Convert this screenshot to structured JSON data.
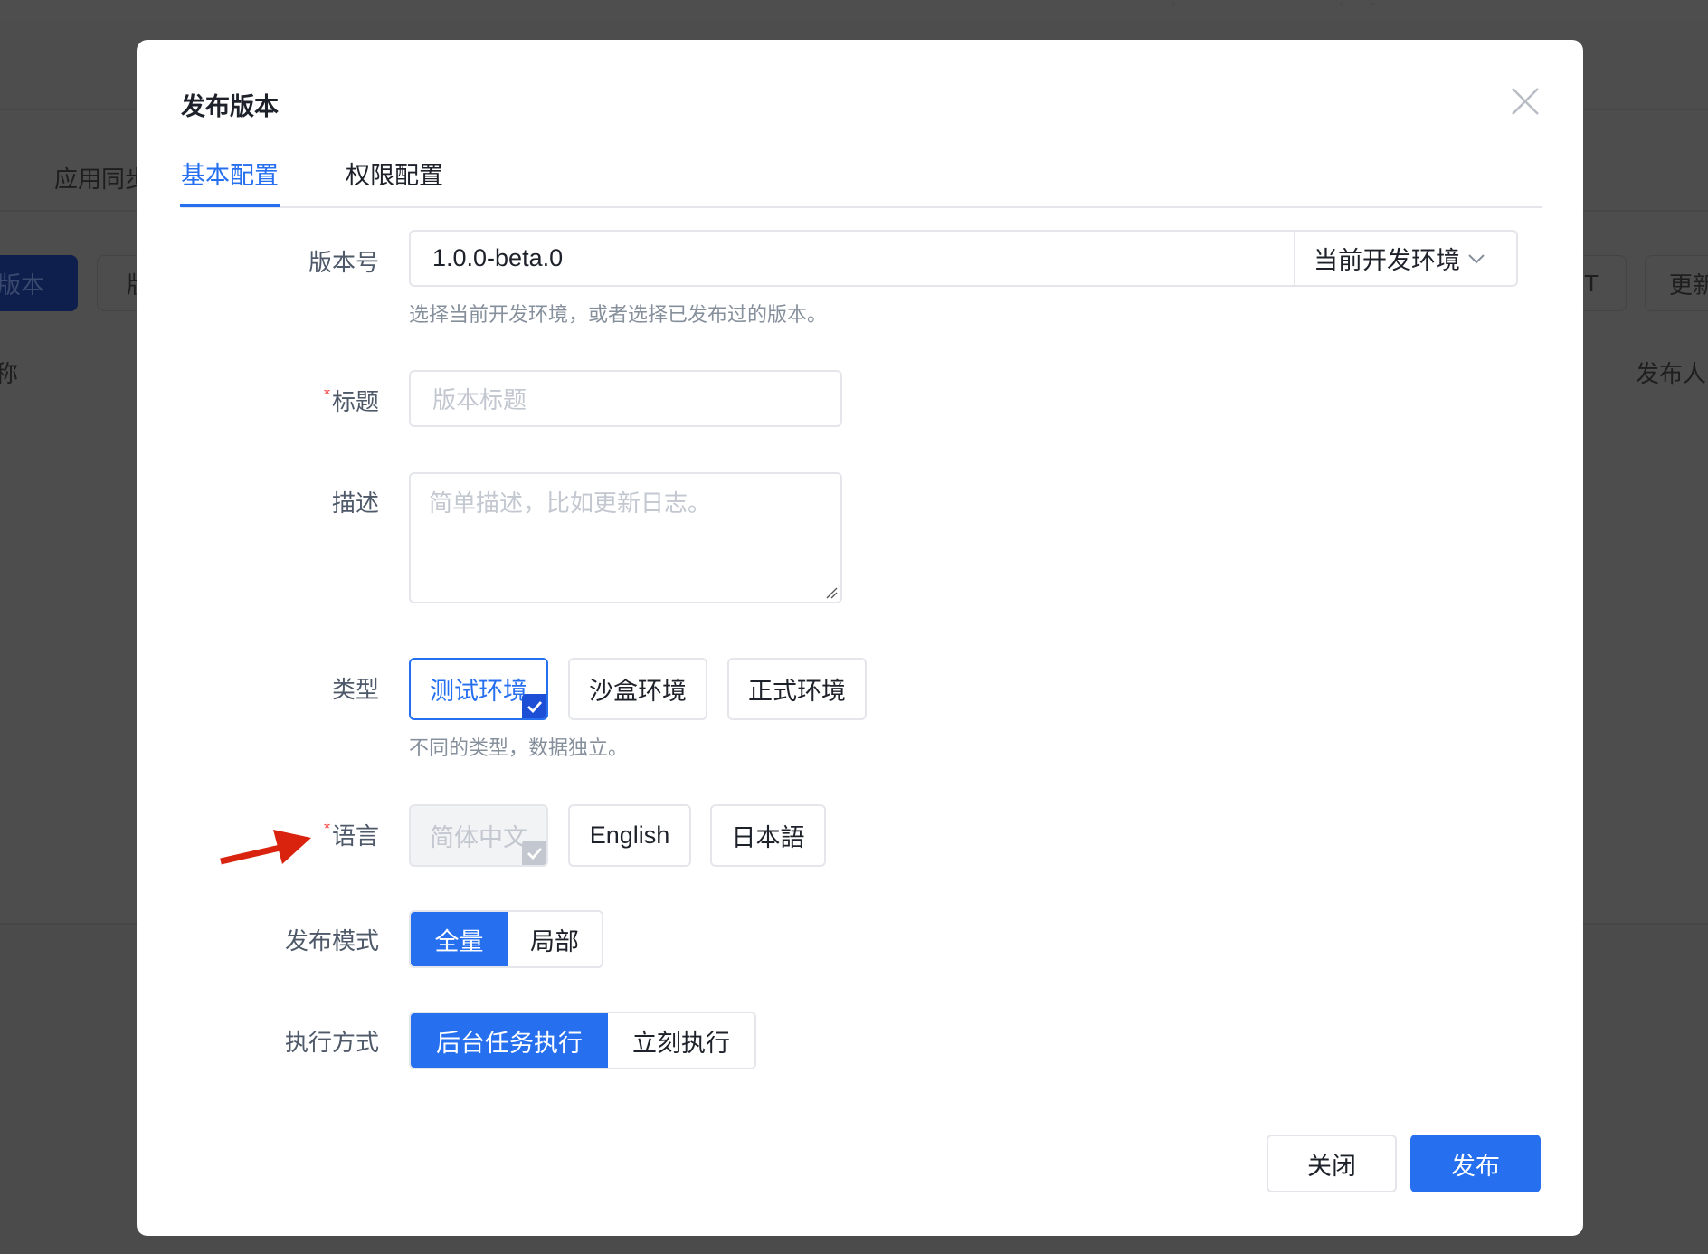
{
  "background": {
    "section_title": "应用同步",
    "primary_button": "版本",
    "secondary_button": "版",
    "right_button_1": "IT",
    "right_button_2": "更新",
    "column_left": "称",
    "column_right": "发布人"
  },
  "dialog": {
    "title": "发布版本",
    "close_icon": "close-icon",
    "tabs": [
      {
        "label": "基本配置",
        "active": true
      },
      {
        "label": "权限配置",
        "active": false
      }
    ],
    "version": {
      "label": "版本号",
      "value": "1.0.0-beta.0",
      "select_value": "当前开发环境",
      "hint": "选择当前开发环境，或者选择已发布过的版本。"
    },
    "title_field": {
      "label": "标题",
      "required": "*",
      "placeholder": "版本标题"
    },
    "description": {
      "label": "描述",
      "placeholder": "简单描述，比如更新日志。"
    },
    "type": {
      "label": "类型",
      "options": [
        {
          "label": "测试环境",
          "selected": true
        },
        {
          "label": "沙盒环境",
          "selected": false
        },
        {
          "label": "正式环境",
          "selected": false
        }
      ],
      "hint": "不同的类型，数据独立。"
    },
    "language": {
      "label": "语言",
      "required": "*",
      "options": [
        {
          "label": "简体中文",
          "selected": true,
          "disabled": true
        },
        {
          "label": "English",
          "selected": false
        },
        {
          "label": "日本語",
          "selected": false
        }
      ]
    },
    "publish_mode": {
      "label": "发布模式",
      "options": [
        {
          "label": "全量",
          "active": true
        },
        {
          "label": "局部",
          "active": false
        }
      ]
    },
    "exec_mode": {
      "label": "执行方式",
      "options": [
        {
          "label": "后台任务执行",
          "active": true
        },
        {
          "label": "立刻执行",
          "active": false
        }
      ]
    },
    "footer": {
      "close_label": "关闭",
      "publish_label": "发布"
    }
  },
  "annotation": {
    "icon": "red-arrow-icon",
    "color": "#d9230f"
  },
  "colors": {
    "primary": "#2670f0",
    "required": "#f53f3f",
    "overlay": "#4b4b4b"
  }
}
